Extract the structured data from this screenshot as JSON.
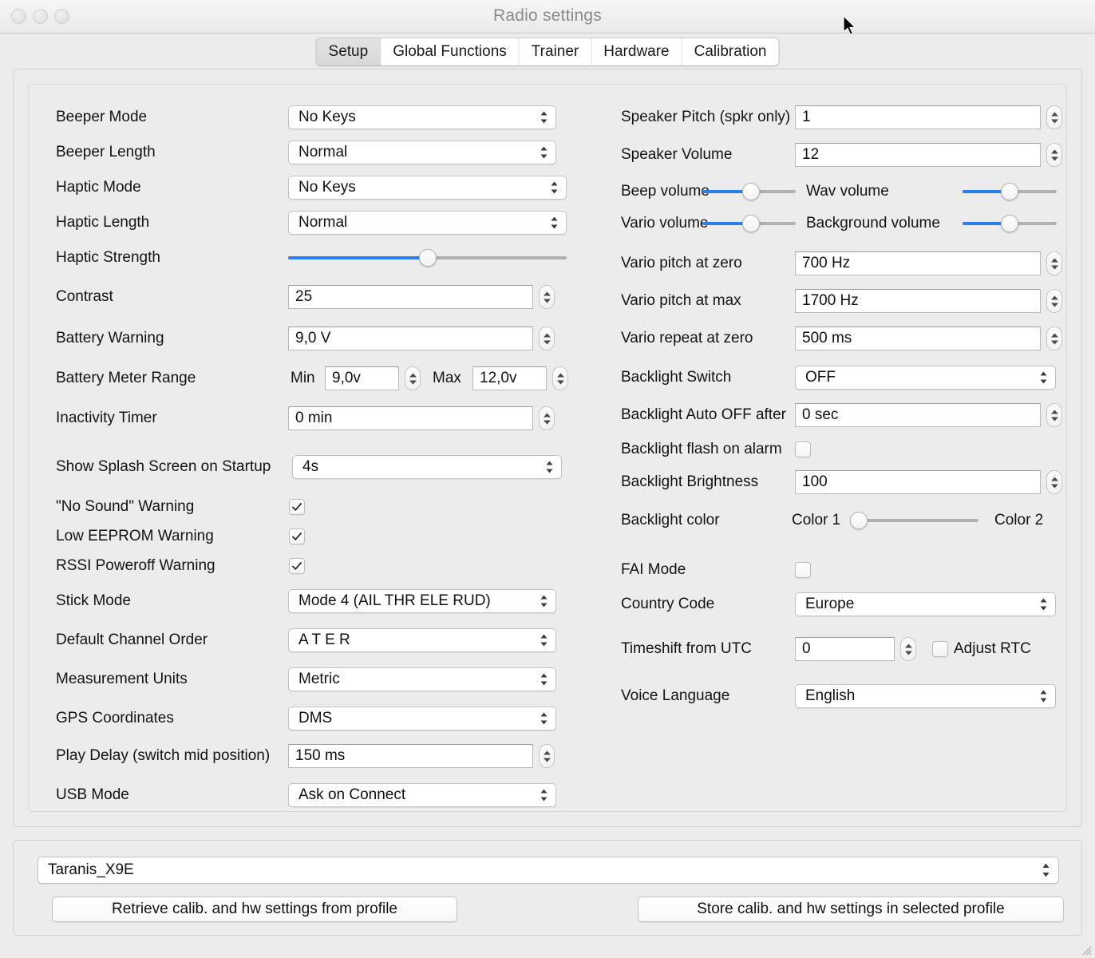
{
  "window": {
    "title": "Radio settings"
  },
  "tabs": [
    {
      "label": "Setup",
      "active": true
    },
    {
      "label": "Global Functions",
      "active": false
    },
    {
      "label": "Trainer",
      "active": false
    },
    {
      "label": "Hardware",
      "active": false
    },
    {
      "label": "Calibration",
      "active": false
    }
  ],
  "left": {
    "beeper_mode": {
      "label": "Beeper Mode",
      "value": "No Keys"
    },
    "beeper_length": {
      "label": "Beeper Length",
      "value": "Normal"
    },
    "haptic_mode": {
      "label": "Haptic Mode",
      "value": "No Keys"
    },
    "haptic_length": {
      "label": "Haptic Length",
      "value": "Normal"
    },
    "haptic_strength": {
      "label": "Haptic Strength",
      "percent": 50
    },
    "contrast": {
      "label": "Contrast",
      "value": "25"
    },
    "battery_warning": {
      "label": "Battery Warning",
      "value": "9,0 V"
    },
    "battery_meter": {
      "label": "Battery Meter Range",
      "min_label": "Min",
      "min_value": "9,0v",
      "max_label": "Max",
      "max_value": "12,0v"
    },
    "inactivity_timer": {
      "label": "Inactivity Timer",
      "value": "0 min"
    },
    "splash_screen": {
      "label": "Show Splash Screen on Startup",
      "value": "4s"
    },
    "no_sound_warning": {
      "label": "\"No Sound\" Warning",
      "checked": true
    },
    "low_eeprom_warning": {
      "label": "Low EEPROM Warning",
      "checked": true
    },
    "rssi_warning": {
      "label": "RSSI Poweroff Warning",
      "checked": true
    },
    "stick_mode": {
      "label": "Stick Mode",
      "value": "Mode 4 (AIL THR ELE RUD)"
    },
    "channel_order": {
      "label": "Default Channel Order",
      "value": "A T E R"
    },
    "measurement_units": {
      "label": "Measurement Units",
      "value": "Metric"
    },
    "gps_coordinates": {
      "label": "GPS Coordinates",
      "value": "DMS"
    },
    "play_delay": {
      "label": "Play Delay (switch mid position)",
      "value": "150 ms"
    },
    "usb_mode": {
      "label": "USB Mode",
      "value": "Ask on Connect"
    }
  },
  "right": {
    "speaker_pitch": {
      "label": "Speaker Pitch (spkr only)",
      "value": "1"
    },
    "speaker_volume": {
      "label": "Speaker Volume",
      "value": "12"
    },
    "beep_volume": {
      "label": "Beep volume",
      "percent": 52
    },
    "wav_volume": {
      "label": "Wav volume",
      "percent": 50
    },
    "vario_volume": {
      "label": "Vario volume",
      "percent": 52
    },
    "background_volume": {
      "label": "Background volume",
      "percent": 50
    },
    "vario_pitch_zero": {
      "label": "Vario pitch at zero",
      "value": "700 Hz"
    },
    "vario_pitch_max": {
      "label": "Vario pitch at max",
      "value": "1700 Hz"
    },
    "vario_repeat_zero": {
      "label": "Vario repeat at zero",
      "value": "500 ms"
    },
    "backlight_switch": {
      "label": "Backlight Switch",
      "value": "OFF"
    },
    "backlight_auto_off": {
      "label": "Backlight  Auto OFF after",
      "value": "0 sec"
    },
    "backlight_flash": {
      "label": "Backlight flash on alarm",
      "checked": false
    },
    "backlight_brightness": {
      "label": "Backlight Brightness",
      "value": "100"
    },
    "backlight_color": {
      "label": "Backlight color",
      "left_label": "Color 1",
      "right_label": "Color 2",
      "percent": 0
    },
    "fai_mode": {
      "label": "FAI Mode",
      "checked": false
    },
    "country_code": {
      "label": "Country Code",
      "value": "Europe"
    },
    "timeshift": {
      "label": "Timeshift from UTC",
      "value": "0"
    },
    "adjust_rtc": {
      "label": "Adjust RTC",
      "checked": false
    },
    "voice_language": {
      "label": "Voice Language",
      "value": "English"
    }
  },
  "bottom": {
    "profile": "Taranis_X9E",
    "retrieve_button": "Retrieve calib. and hw settings from profile",
    "store_button": "Store calib. and hw settings in selected profile"
  },
  "colors": {
    "accent": "#2b7fec",
    "track": "#b0b0b0",
    "window_bg": "#ececec"
  }
}
